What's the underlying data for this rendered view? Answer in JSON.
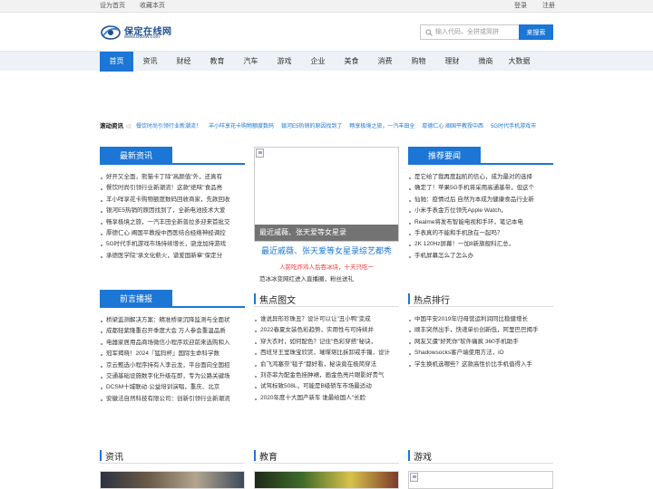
{
  "topbar": {
    "set_home": "设为首页",
    "bookmark": "收藏本页",
    "login": "登录",
    "register": "注册"
  },
  "logo": {
    "title": "保定在线网",
    "sub": "www.bdolw.com"
  },
  "search": {
    "placeholder": "输入代码，全拼或简拼",
    "button": "来搜索"
  },
  "nav": [
    "首页",
    "资讯",
    "财经",
    "教育",
    "汽车",
    "游戏",
    "企业",
    "美食",
    "消费",
    "购物",
    "理财",
    "微商",
    "大数据"
  ],
  "ticker": {
    "label": "滚动资讯",
    "items": [
      "餐饮时尚引领行业新潮流！",
      "羊小咩享花卡购物额度数码",
      "银河E5热销的原因找到了",
      "畅享极境之旅，一汽丰田全",
      "厚德仁心 阐国平教授中西",
      "5G时代手机游戏市"
    ]
  },
  "latest": {
    "title": "最新资讯",
    "items": [
      "好开又全面，熊猫卡丁除\"高颜值\"外，还真有",
      "餐饮时尚引领行业新潮流！这款\"绝味\"食品亮",
      "羊小咩享花卡购物额度数码回收商家，先款回收",
      "银河E5热销的原因找到了，全新电池技术大爱",
      "畅享极境之旅，一汽丰田全新普拉多迎来首批交",
      "厚德仁心 阐国平教授中西医结合经络神经调控",
      "5G时代手机游戏市场持续增长，骁龙加持游戏",
      "承德医学院\"承文化薪火，谱爱国新章\"保定分"
    ]
  },
  "frontier": {
    "title": "前言播报",
    "items": [
      "桥梁监测解决方案：精准桥梁沉降监测与全面状",
      "成都轻紫隆重召开季度大会 万人参会重温品质",
      "电器家居用品商场微信小程序欢迎前来选购和入",
      "冠军揭晓！2024『猛犸杯』国际生命科学数",
      "京云甄选小程序持有人李云龙，平台面向全国招",
      "交通基础设施数字化升级在即，专为公路关键场",
      "DCSM十城联动·公益培训演唱，重庆、北京",
      "安徽法自然科技有限公司：创新引领行业新潮流"
    ]
  },
  "focus": {
    "caption": "最近戚薇、张天爱等女星录",
    "headline": "最近戚薇、张天爱等女星录综艺都秀",
    "subline": "人前吃炸鸡人后吞冰块，十天只吃一",
    "subline2": "范冰冰变网红进入直播圈，粉丝送礼"
  },
  "photo": {
    "title": "焦点图文",
    "items": [
      "谁说异形珍珠丑？设计可以让\"丑小鸭\"变成",
      "2022春夏女装色彩趋势，实用性与可持续并",
      "穿大衣时，如何配色？记住\"色彩穿搭\"秘诀，",
      "西班牙王室珠宝欣赏，璀璨堪比拆卸戒手镯，设计",
      "俞飞鸿塞奈\"毯子\"都好看，秘诀竟在极简穿法",
      "刘亦菲为配金色挂肿裙，画金色亮片眼影好贵气",
      "试驾标致508L，可能是B级轿车市场最适动",
      "2020年度十大国产新车 谁最给国人\"长脸"
    ]
  },
  "recommend": {
    "title": "推荐要闻",
    "items": [
      "是它给了我再度起航的信心，成为最对的选择",
      "确定了！苹果5G手机将采用高通基带，但这个",
      "仙驰：疫情过后 自然为本成为健康食品行业新",
      "小米手表金方位领先Apple Watch，",
      "Realme将发布智能电视和手环，笔记本电",
      "手表真的不能和手机放在一起吗？",
      "2K 120Hz屏幕！一加8新旗舰科汇总，",
      "手机屏幕怎么了怎么办"
    ]
  },
  "hot": {
    "title": "热点排行",
    "items": [
      "中国平安2019年归母营运利润同比稳健增长",
      "顺丰突然出手，快递单价创新低，阿里巴巴揭手",
      "网友又遭\"好死你\"软件痛疯 360手机助手",
      "Shadowsocks客户端使用方法，iO",
      "学生换机选哪些？这款高性价比手机值得入手"
    ]
  },
  "bottom": {
    "news": "资讯",
    "edu": "教育",
    "game": "游戏"
  },
  "colors": {
    "accent": "#1c76d6"
  }
}
